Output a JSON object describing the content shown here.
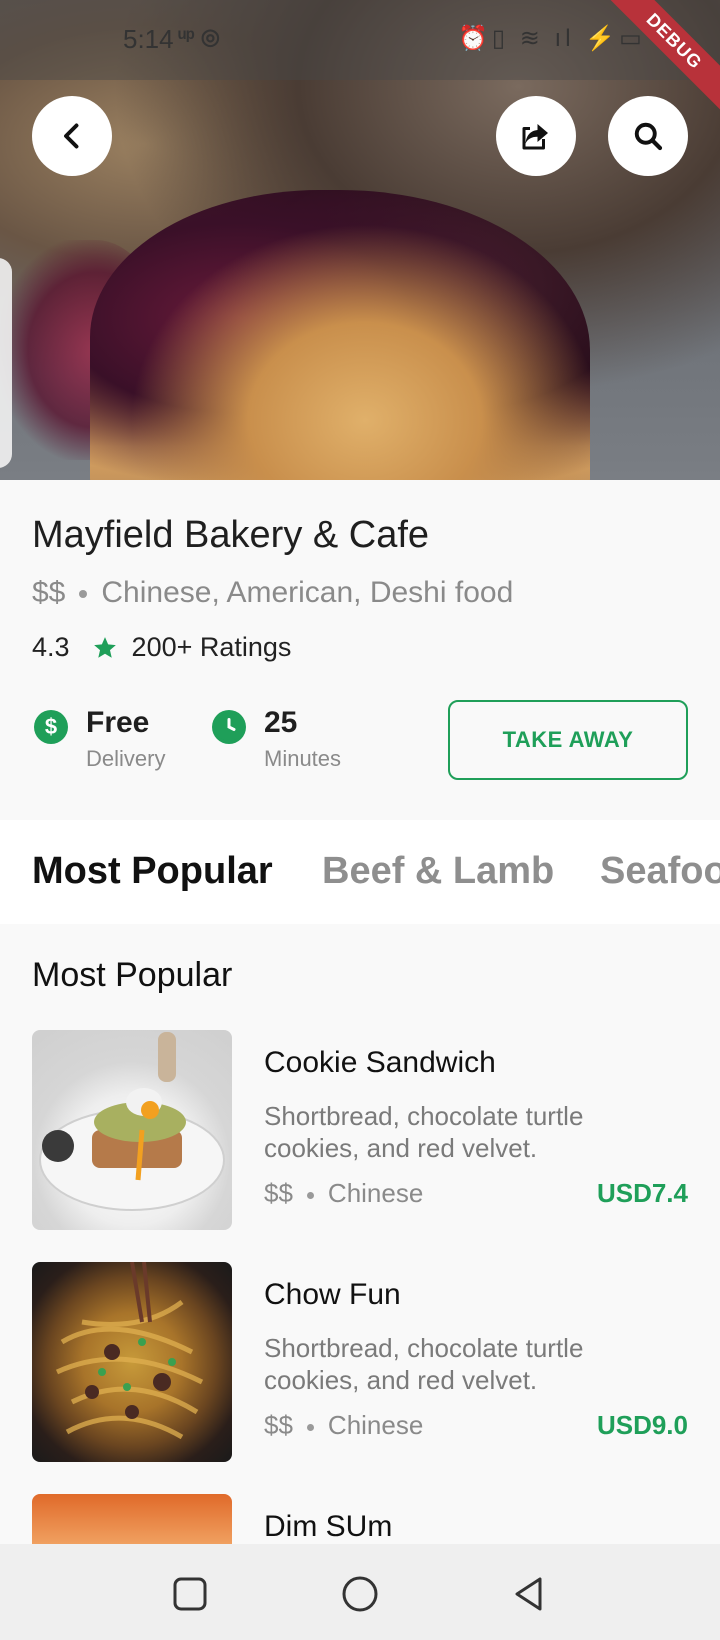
{
  "status": {
    "time": "5:14",
    "left_icons": "ᵘᵖ ◎",
    "right_icons": "⏰▯ ≋ ıl ⚡▭",
    "debug_label": "DEBUG"
  },
  "header": {
    "back_icon": "back-arrow",
    "share_icon": "share",
    "search_icon": "search"
  },
  "restaurant": {
    "name": "Mayfield Bakery & Cafe",
    "price_level": "$$",
    "cuisines": "Chinese, American, Deshi food",
    "rating": "4.3",
    "ratings_count": "200+ Ratings",
    "delivery_icon": "$",
    "delivery_main": "Free",
    "delivery_sub": "Delivery",
    "time_main": "25",
    "time_sub": "Minutes",
    "takeaway_label": "TAKE AWAY"
  },
  "tabs": [
    "Most Popular",
    "Beef & Lamb",
    "Seafood"
  ],
  "menu": {
    "section_title": "Most Popular",
    "items": [
      {
        "name": "Cookie Sandwich",
        "desc": "Shortbread, chocolate turtle cookies, and red velvet.",
        "price_level": "$$",
        "cuisine": "Chinese",
        "price": "USD7.4"
      },
      {
        "name": "Chow Fun",
        "desc": "Shortbread, chocolate turtle cookies, and red velvet.",
        "price_level": "$$",
        "cuisine": "Chinese",
        "price": "USD9.0"
      },
      {
        "name": "Dim SUm"
      }
    ]
  },
  "colors": {
    "accent": "#1f9f59",
    "debug": "#b8323a"
  }
}
